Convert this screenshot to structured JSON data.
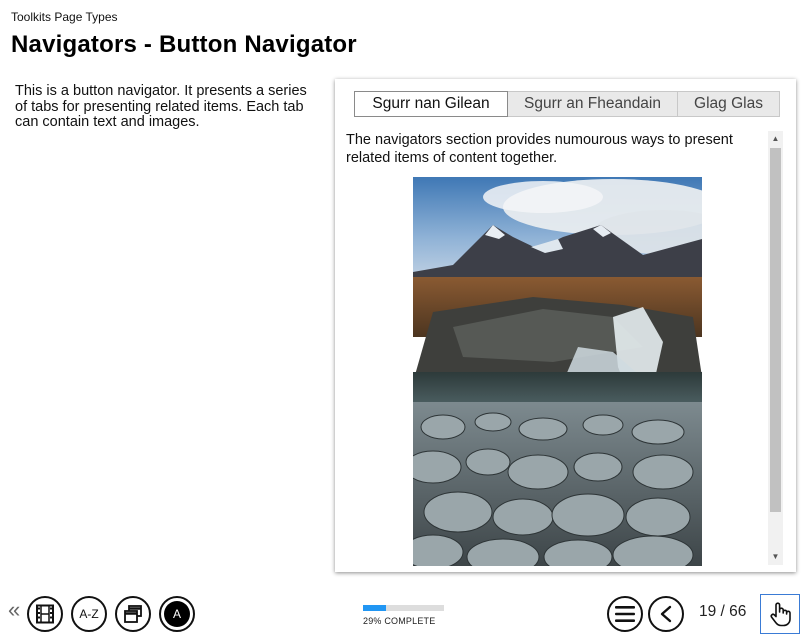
{
  "breadcrumb": "Toolkits Page Types",
  "page_title": "Navigators - Button Navigator",
  "intro": "This is a button navigator. It presents a series of tabs for presenting related items. Each tab can contain text and images.",
  "tabs": [
    {
      "label": "Sgurr nan Gilean",
      "active": true
    },
    {
      "label": "Sgurr an Fheandain",
      "active": false
    },
    {
      "label": "Glag Glas",
      "active": false
    }
  ],
  "content": {
    "text": "The navigators section provides numourous ways to present related items of content together.",
    "image_icon": "mountain-waterfall-photo"
  },
  "footer": {
    "back_icon": "double-chevron-left-icon",
    "buttons": [
      {
        "icon": "film-icon"
      },
      {
        "label": "A-Z",
        "icon": "glossary-icon"
      },
      {
        "icon": "windows-icon"
      },
      {
        "label": "A",
        "icon": "accessibility-icon"
      }
    ],
    "progress": {
      "percent": 29,
      "label": "29% COMPLETE"
    },
    "menu_icon": "hamburger-icon",
    "prev_icon": "chevron-left-icon",
    "page_count": "19 / 66",
    "next_icon": "hand-pointer-icon"
  },
  "colors": {
    "progress_fill": "#2196f3",
    "progress_track": "#dddddd",
    "tab_inactive_bg": "#e9e9e9",
    "next_border": "#3a7bd5"
  }
}
